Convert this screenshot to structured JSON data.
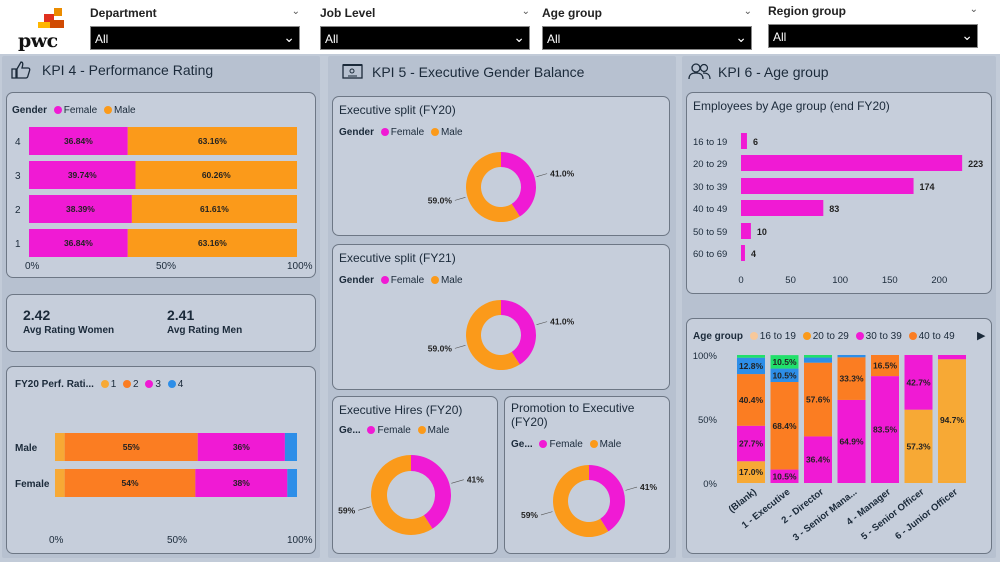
{
  "brand": {
    "logo_text": "pwc"
  },
  "filters": [
    {
      "label": "Department",
      "value": "All"
    },
    {
      "label": "Job Level",
      "value": "All"
    },
    {
      "label": "Age group",
      "value": "All"
    },
    {
      "label": "Region group",
      "value": "All"
    }
  ],
  "colors": {
    "female": "#f01ad4",
    "male": "#fb9a1a",
    "r1": "#f7a935",
    "r2": "#fb7d22",
    "r3": "#f01ad4",
    "r4": "#2d8ee8"
  },
  "kpi4": {
    "title": "KPI 4 - Performance Rating",
    "gender_chart": {
      "legend_title": "Gender",
      "legend_female": "Female",
      "legend_male": "Male",
      "x_ticks": [
        "0%",
        "50%",
        "100%"
      ]
    },
    "avg_women": {
      "value": "2.42",
      "label": "Avg Rating Women"
    },
    "avg_men": {
      "value": "2.41",
      "label": "Avg Rating Men"
    },
    "perf_chart": {
      "legend_title": "FY20 Perf. Rati...",
      "legend_items": [
        "1",
        "2",
        "3",
        "4"
      ],
      "x_ticks": [
        "0%",
        "50%",
        "100%"
      ]
    }
  },
  "kpi5": {
    "title": "KPI 5 - Executive Gender Balance",
    "split20": {
      "title": "Executive split (FY20)",
      "legend_title": "Gender",
      "legend_female": "Female",
      "legend_male": "Male"
    },
    "split21": {
      "title": "Executive split (FY21)",
      "legend_title": "Gender",
      "legend_female": "Female",
      "legend_male": "Male"
    },
    "hires": {
      "title": "Executive Hires (FY20)",
      "legend_title": "Ge...",
      "legend_female": "Female",
      "legend_male": "Male"
    },
    "promo": {
      "title_line1": "Promotion to Executive",
      "title_line2": "(FY20)",
      "legend_title": "Ge...",
      "legend_female": "Female",
      "legend_male": "Male"
    }
  },
  "kpi6": {
    "title": "KPI 6 - Age group",
    "age_bar": {
      "title": "Employees by Age group (end FY20)"
    },
    "age_stack": {
      "legend_title": "Age group",
      "legend_items": [
        "16 to 19",
        "20 to 29",
        "30 to 39",
        "40 to 49"
      ]
    }
  },
  "chart_data": [
    {
      "type": "bar",
      "id": "perf_by_gender",
      "orientation": "horizontal-stacked-100",
      "categories": [
        "4",
        "3",
        "2",
        "1"
      ],
      "series": [
        {
          "name": "Female",
          "values": [
            36.84,
            39.74,
            38.39,
            36.84
          ],
          "labels": [
            "36.84%",
            "39.74%",
            "38.39%",
            "36.84%"
          ]
        },
        {
          "name": "Male",
          "values": [
            63.16,
            60.26,
            61.61,
            63.16
          ],
          "labels": [
            "63.16%",
            "60.26%",
            "61.61%",
            "63.16%"
          ]
        }
      ],
      "xlim": [
        0,
        100
      ]
    },
    {
      "type": "bar",
      "id": "fy20_perf_rating",
      "orientation": "horizontal-stacked-100",
      "categories": [
        "Male",
        "Female"
      ],
      "series": [
        {
          "name": "1",
          "values": [
            4,
            4
          ],
          "labels": [
            "",
            ""
          ]
        },
        {
          "name": "2",
          "values": [
            55,
            54
          ],
          "labels": [
            "55%",
            "54%"
          ]
        },
        {
          "name": "3",
          "values": [
            36,
            38
          ],
          "labels": [
            "36%",
            "38%"
          ]
        },
        {
          "name": "4",
          "values": [
            5,
            4
          ],
          "labels": [
            "",
            ""
          ]
        }
      ],
      "xlim": [
        0,
        100
      ]
    },
    {
      "type": "pie",
      "id": "split20",
      "donut": true,
      "categories": [
        "Female",
        "Male"
      ],
      "values": [
        41.0,
        59.0
      ],
      "labels": [
        "41.0%",
        "59.0%"
      ]
    },
    {
      "type": "pie",
      "id": "split21",
      "donut": true,
      "categories": [
        "Female",
        "Male"
      ],
      "values": [
        41.0,
        59.0
      ],
      "labels": [
        "41.0%",
        "59.0%"
      ]
    },
    {
      "type": "pie",
      "id": "hires",
      "donut": true,
      "categories": [
        "Female",
        "Male"
      ],
      "values": [
        41,
        59
      ],
      "labels": [
        "41%",
        "59%"
      ]
    },
    {
      "type": "pie",
      "id": "promo",
      "donut": true,
      "categories": [
        "Female",
        "Male"
      ],
      "values": [
        41,
        59
      ],
      "labels": [
        "41%",
        "59%"
      ]
    },
    {
      "type": "bar",
      "id": "age_count",
      "orientation": "horizontal",
      "categories": [
        "16 to 19",
        "20 to 29",
        "30 to 39",
        "40 to 49",
        "50 to 59",
        "60 to 69"
      ],
      "values": [
        6,
        223,
        174,
        83,
        10,
        4
      ],
      "x_ticks": [
        "0",
        "50",
        "100",
        "150",
        "200"
      ],
      "xlim": [
        0,
        240
      ]
    },
    {
      "type": "bar",
      "id": "age_by_level",
      "orientation": "vertical-stacked-100",
      "categories": [
        "(Blank)",
        "1 - Executive",
        "2 - Director",
        "3 - Senior Mana...",
        "4 - Manager",
        "5 - Senior Officer",
        "6 - Junior Officer"
      ],
      "y_ticks": [
        "100%",
        "50%",
        "0%"
      ],
      "series": [
        {
          "name": "16 to 19",
          "values": [
            0,
            0,
            0,
            0,
            0,
            0,
            2
          ],
          "labels": [
            "",
            "",
            "",
            "",
            "",
            "",
            ""
          ]
        },
        {
          "name": "20 to 29",
          "values": [
            17.0,
            0,
            0,
            0,
            0,
            57.3,
            94.7
          ],
          "labels": [
            "17.0%",
            "",
            "",
            "",
            "",
            "57.3%",
            "94.7%"
          ]
        },
        {
          "name": "30 to 39",
          "values": [
            27.7,
            10.5,
            36.4,
            64.9,
            83.5,
            42.7,
            3.3
          ],
          "labels": [
            "27.7%",
            "10.5%",
            "36.4%",
            "64.9%",
            "83.5%",
            "42.7%",
            ""
          ]
        },
        {
          "name": "40 to 49",
          "values": [
            40.4,
            68.4,
            57.6,
            33.3,
            16.5,
            0,
            0
          ],
          "labels": [
            "40.4%",
            "68.4%",
            "57.6%",
            "33.3%",
            "16.5%",
            "",
            ""
          ]
        },
        {
          "name": "50 to 59",
          "values": [
            12.8,
            10.5,
            4.0,
            1.8,
            0,
            0,
            0
          ],
          "labels": [
            "12.8%",
            "10.5%",
            "",
            "",
            "",
            "",
            ""
          ]
        },
        {
          "name": "60 to 69",
          "values": [
            2.1,
            10.5,
            2.0,
            0,
            0,
            0,
            0
          ],
          "labels": [
            "",
            "10.5%",
            "",
            "",
            "",
            "",
            ""
          ]
        }
      ],
      "series_colors": [
        "#f7a935",
        "#f7a935",
        "#f01ad4",
        "#fb7d22",
        "#2d8ee8",
        "#21e06b"
      ]
    }
  ]
}
